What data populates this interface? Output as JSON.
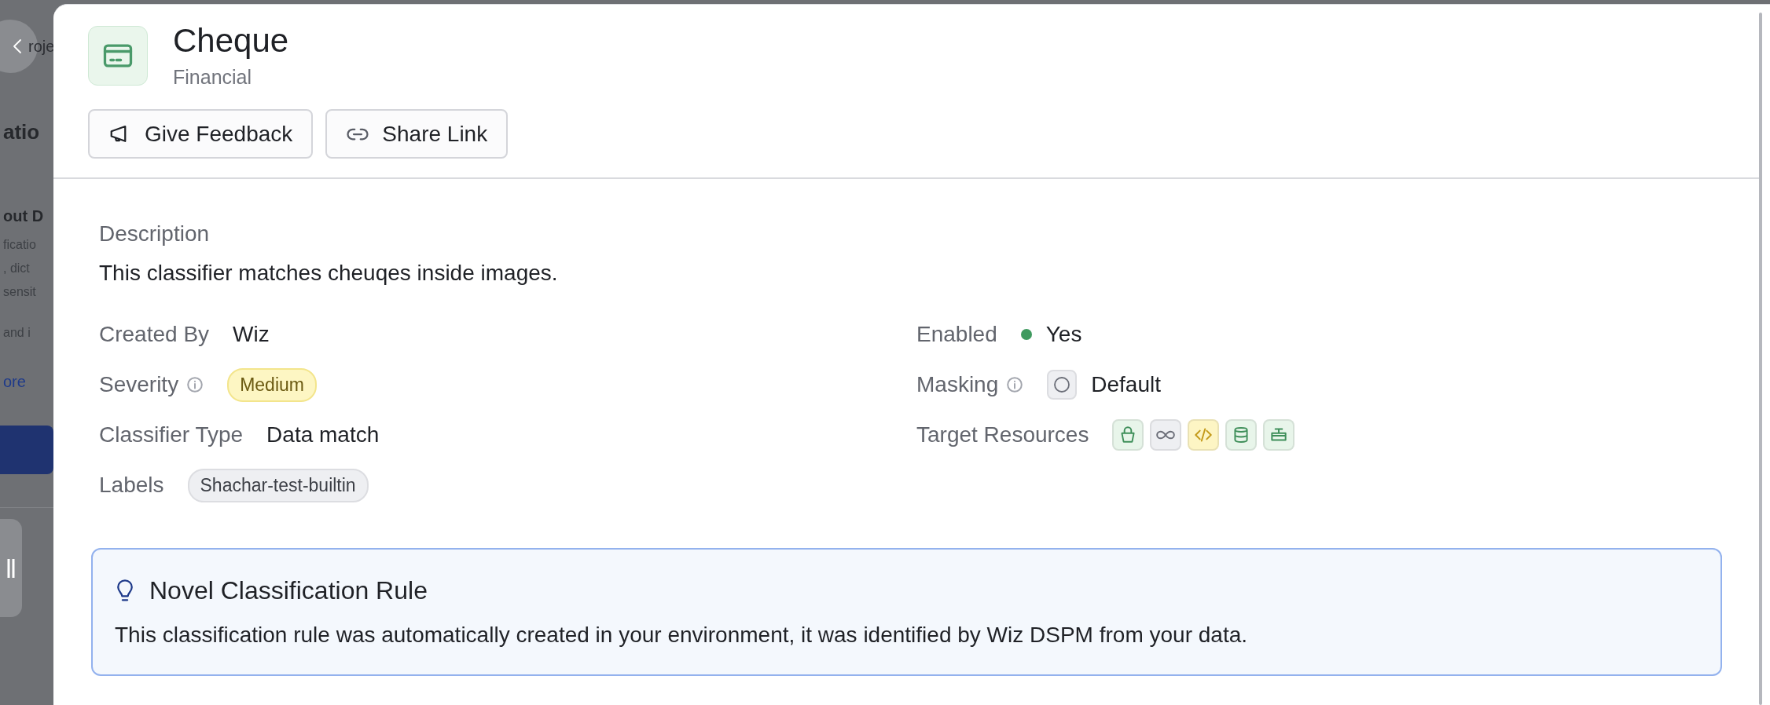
{
  "backdrop": {
    "crumb": "roje",
    "heading": "atio",
    "subheading": "out D",
    "paragraph_lines": [
      "ficatio",
      ", dict",
      "sensit"
    ],
    "line_4": "and i",
    "link": "ore"
  },
  "header": {
    "title": "Cheque",
    "category": "Financial"
  },
  "actions": [
    {
      "label": "Give Feedback",
      "kind": "feedback"
    },
    {
      "label": "Share Link",
      "kind": "share"
    }
  ],
  "details": {
    "description_label": "Description",
    "description": "This classifier matches cheuqes inside images.",
    "left": [
      {
        "kind": "text",
        "label": "Created By",
        "info": false,
        "value": "Wiz"
      },
      {
        "kind": "badge",
        "label": "Severity",
        "info": true,
        "value": "Medium"
      },
      {
        "kind": "text",
        "label": "Classifier Type",
        "info": false,
        "value": "Data match"
      },
      {
        "kind": "chip",
        "label": "Labels",
        "info": false,
        "value": "Shachar-test-builtin"
      }
    ],
    "right": [
      {
        "kind": "status",
        "label": "Enabled",
        "info": false,
        "on": true,
        "value": "Yes"
      },
      {
        "kind": "masking",
        "label": "Masking",
        "info": true,
        "value": "Default"
      },
      {
        "kind": "resources",
        "label": "Target Resources",
        "info": false,
        "resources": [
          {
            "kind": "bucket",
            "color": "#e8f5ea"
          },
          {
            "kind": "infinity",
            "color": "#eeeff2"
          },
          {
            "kind": "code",
            "color": "#fdf5c4"
          },
          {
            "kind": "database",
            "color": "#e8f5ea"
          },
          {
            "kind": "server",
            "color": "#e8f5ea"
          }
        ]
      }
    ]
  },
  "banner": {
    "title": "Novel Classification Rule",
    "text": "This classification rule was automatically created in your environment, it was identified by Wiz DSPM from your data."
  }
}
